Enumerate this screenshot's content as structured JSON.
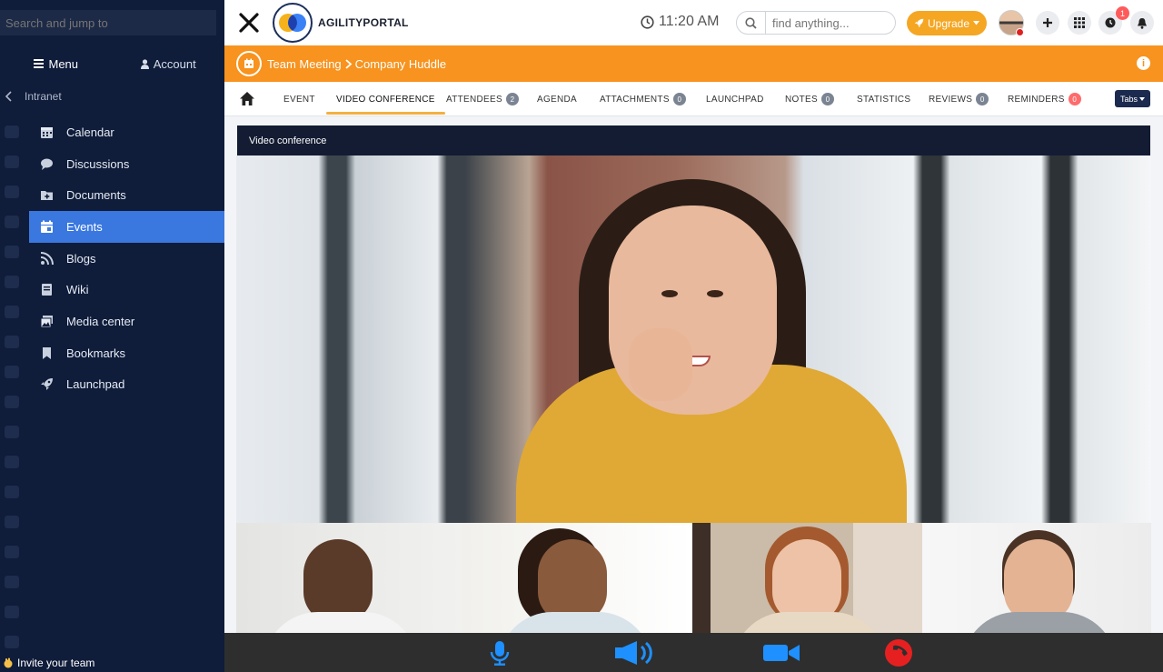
{
  "sidebar": {
    "search_placeholder": "Search and jump to",
    "tabs": {
      "menu": "Menu",
      "account": "Account"
    },
    "breadcrumb": "Intranet",
    "items": [
      {
        "label": "Calendar",
        "icon": "calendar-icon"
      },
      {
        "label": "Discussions",
        "icon": "chat-bubble-icon"
      },
      {
        "label": "Documents",
        "icon": "folder-plus-icon"
      },
      {
        "label": "Events",
        "icon": "calendar-event-icon",
        "active": true
      },
      {
        "label": "Blogs",
        "icon": "rss-icon"
      },
      {
        "label": "Wiki",
        "icon": "book-icon"
      },
      {
        "label": "Media center",
        "icon": "images-icon"
      },
      {
        "label": "Bookmarks",
        "icon": "bookmark-icon"
      },
      {
        "label": "Launchpad",
        "icon": "rocket-icon"
      }
    ],
    "invite_label": "Invite your team"
  },
  "header": {
    "brand": "AGILITYPORTAL",
    "time": "11:20 AM",
    "search_placeholder": "find anything...",
    "upgrade_label": "Upgrade",
    "notification_count": "1"
  },
  "breadcrumb_bar": {
    "parent": "Team Meeting",
    "current": "Company Huddle"
  },
  "tabs": [
    {
      "label": "EVENT"
    },
    {
      "label": "VIDEO CONFERENCE",
      "active": true
    },
    {
      "label": "ATTENDEES",
      "badge": "2"
    },
    {
      "label": "AGENDA"
    },
    {
      "label": "ATTACHMENTS",
      "badge": "0"
    },
    {
      "label": "LAUNCHPAD"
    },
    {
      "label": "NOTES",
      "badge": "0"
    },
    {
      "label": "STATISTICS"
    },
    {
      "label": "REVIEWS",
      "badge": "0"
    },
    {
      "label": "REMINDERS",
      "badge": "0",
      "badge_color": "red"
    }
  ],
  "tabs_dropdown_label": "Tabs",
  "video_conference": {
    "title": "Video conference",
    "controls": [
      "microphone-icon",
      "speaker-icon",
      "video-camera-icon",
      "end-call-icon"
    ]
  },
  "colors": {
    "sidebar_bg": "#0f1c3a",
    "active_item": "#3a78e0",
    "accent_orange": "#f7931e",
    "upgrade": "#f5a623",
    "control_blue": "#1e90ff",
    "end_call_red": "#e62020"
  }
}
